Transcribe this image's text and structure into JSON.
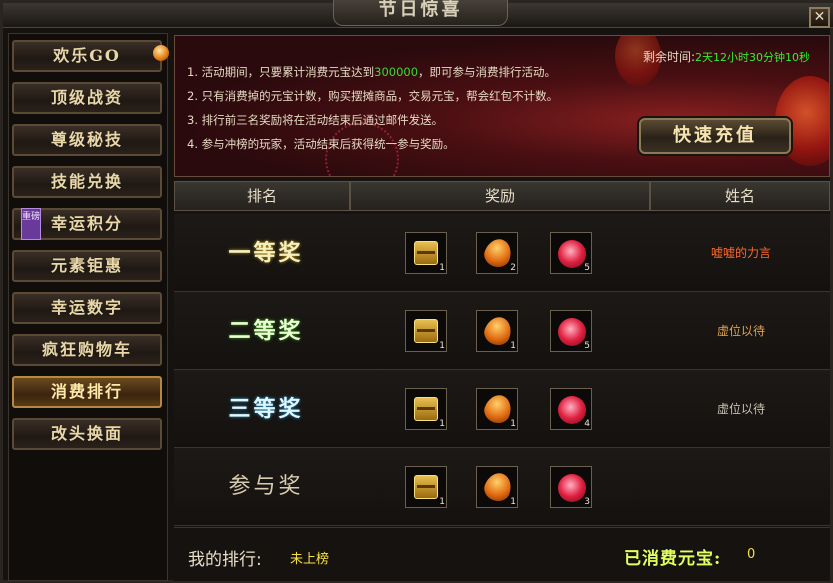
{
  "window": {
    "title": "节日惊喜",
    "close_glyph": "✕"
  },
  "sidebar": {
    "items": [
      {
        "label": "欢乐GO",
        "badge": "orb"
      },
      {
        "label": "顶级战资"
      },
      {
        "label": "尊级秘技"
      },
      {
        "label": "技能兑换"
      },
      {
        "label": "幸运积分",
        "tag": "重磅"
      },
      {
        "label": "元素钜惠"
      },
      {
        "label": "幸运数字"
      },
      {
        "label": "疯狂购物车"
      },
      {
        "label": "消费排行",
        "active": true
      },
      {
        "label": "改头换面"
      }
    ]
  },
  "banner": {
    "rules": [
      {
        "pre": "1. 活动期间，只要累计消费元宝达到",
        "highlight": "300000",
        "post": "，即可参与消费排行活动。"
      },
      {
        "pre": "2. 只有消费掉的元宝计数，购买摆摊商品，交易元宝，帮会红包不计数。",
        "highlight": "",
        "post": ""
      },
      {
        "pre": "3. 排行前三名奖励将在活动结束后通过邮件发送。",
        "highlight": "",
        "post": ""
      },
      {
        "pre": "4. 参与冲榜的玩家，活动结束后获得统一参与奖励。",
        "highlight": "",
        "post": ""
      }
    ],
    "countdown_label": "剩余时间:",
    "countdown_value": "2天12小时30分钟10秒",
    "recharge_label": "快速充值"
  },
  "table": {
    "headers": {
      "rank": "排名",
      "reward": "奖励",
      "name": "姓名"
    },
    "rows": [
      {
        "rank": "一等奖",
        "rank_class": "r1",
        "name": "嘘嘘的力言",
        "name_color": "#ff6a2a",
        "rewards": [
          {
            "icon": "treasure-chest-icon",
            "count": "1"
          },
          {
            "icon": "amber-gem-icon",
            "count": "2"
          },
          {
            "icon": "red-rose-icon",
            "count": "5"
          }
        ]
      },
      {
        "rank": "二等奖",
        "rank_class": "r2",
        "name": "虚位以待",
        "name_color": "#e0a050",
        "rewards": [
          {
            "icon": "treasure-chest-icon",
            "count": "1"
          },
          {
            "icon": "amber-gem-icon",
            "count": "1"
          },
          {
            "icon": "red-rose-icon",
            "count": "5"
          }
        ]
      },
      {
        "rank": "三等奖",
        "rank_class": "r3",
        "name": "虚位以待",
        "name_color": "#c8c0b0",
        "rewards": [
          {
            "icon": "treasure-chest-icon",
            "count": "1"
          },
          {
            "icon": "amber-gem-icon",
            "count": "1"
          },
          {
            "icon": "red-rose-icon",
            "count": "4"
          }
        ]
      },
      {
        "rank": "参与奖",
        "rank_class": "r4",
        "name": "",
        "rewards": [
          {
            "icon": "treasure-chest-icon",
            "count": "1"
          },
          {
            "icon": "amber-gem-icon",
            "count": "1"
          },
          {
            "icon": "red-rose-icon",
            "count": "3"
          }
        ]
      }
    ]
  },
  "footer": {
    "my_rank_label": "我的排行:",
    "my_rank_value": "未上榜",
    "spent_label": "已消费元宝:",
    "spent_value": "0"
  }
}
